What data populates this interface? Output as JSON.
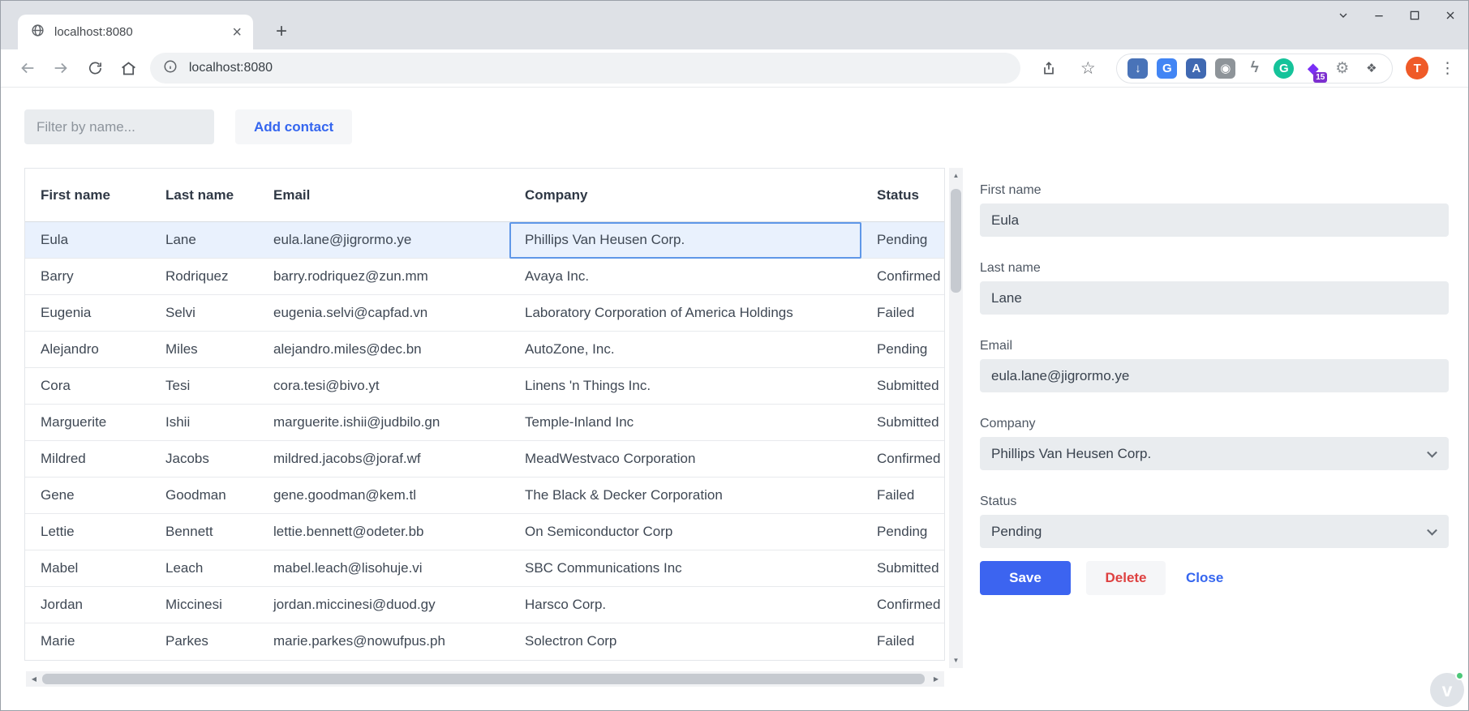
{
  "browser": {
    "tab_title": "localhost:8080",
    "url": "localhost:8080",
    "new_tab_label": "+",
    "tab_close_glyph": "×",
    "kebab_glyph": "⋮",
    "star_glyph": "☆",
    "profile_initial": "T",
    "extensions": [
      {
        "name": "download-extension-icon",
        "glyph": "↓",
        "bg": "#4973b8",
        "fg": "#ffffff",
        "round": false
      },
      {
        "name": "google-translate-icon",
        "glyph": "G",
        "bg": "#4285f4",
        "fg": "#ffffff",
        "round": false
      },
      {
        "name": "input-tools-icon",
        "glyph": "A",
        "bg": "#4069b2",
        "fg": "#ffffff",
        "round": false
      },
      {
        "name": "screenshot-camera-icon",
        "glyph": "◉",
        "bg": "#8e9499",
        "fg": "#ffffff",
        "round": false
      },
      {
        "name": "lightning-extension-icon",
        "glyph": "ϟ",
        "bg": "",
        "fg": "#80868b",
        "round": false
      },
      {
        "name": "grammarly-icon",
        "glyph": "G",
        "bg": "#15c39a",
        "fg": "#ffffff",
        "round": true
      },
      {
        "name": "purple-extension-icon",
        "glyph": "◆",
        "bg": "",
        "fg": "#7a2ff5",
        "round": false,
        "badge": "15"
      },
      {
        "name": "settings-gear-extension-icon",
        "glyph": "⚙",
        "bg": "",
        "fg": "#8b9095",
        "round": false
      },
      {
        "name": "extensions-puzzle-icon",
        "glyph": "❖",
        "bg": "",
        "fg": "#5f6368",
        "round": false
      }
    ]
  },
  "page": {
    "filter_placeholder": "Filter by name...",
    "add_contact_label": "Add contact"
  },
  "table": {
    "columns": [
      "First name",
      "Last name",
      "Email",
      "Company",
      "Status"
    ],
    "selected_row_index": 0,
    "focused_column": "company",
    "rows": [
      {
        "first": "Eula",
        "last": "Lane",
        "email": "eula.lane@jigrormo.ye",
        "company": "Phillips Van Heusen Corp.",
        "status": "Pending"
      },
      {
        "first": "Barry",
        "last": "Rodriquez",
        "email": "barry.rodriquez@zun.mm",
        "company": "Avaya Inc.",
        "status": "Confirmed"
      },
      {
        "first": "Eugenia",
        "last": "Selvi",
        "email": "eugenia.selvi@capfad.vn",
        "company": "Laboratory Corporation of America Holdings",
        "status": "Failed"
      },
      {
        "first": "Alejandro",
        "last": "Miles",
        "email": "alejandro.miles@dec.bn",
        "company": "AutoZone, Inc.",
        "status": "Pending"
      },
      {
        "first": "Cora",
        "last": "Tesi",
        "email": "cora.tesi@bivo.yt",
        "company": "Linens 'n Things Inc.",
        "status": "Submitted"
      },
      {
        "first": "Marguerite",
        "last": "Ishii",
        "email": "marguerite.ishii@judbilo.gn",
        "company": "Temple-Inland Inc",
        "status": "Submitted"
      },
      {
        "first": "Mildred",
        "last": "Jacobs",
        "email": "mildred.jacobs@joraf.wf",
        "company": "MeadWestvaco Corporation",
        "status": "Confirmed"
      },
      {
        "first": "Gene",
        "last": "Goodman",
        "email": "gene.goodman@kem.tl",
        "company": "The Black & Decker Corporation",
        "status": "Failed"
      },
      {
        "first": "Lettie",
        "last": "Bennett",
        "email": "lettie.bennett@odeter.bb",
        "company": "On Semiconductor Corp",
        "status": "Pending"
      },
      {
        "first": "Mabel",
        "last": "Leach",
        "email": "mabel.leach@lisohuje.vi",
        "company": "SBC Communications Inc",
        "status": "Submitted"
      },
      {
        "first": "Jordan",
        "last": "Miccinesi",
        "email": "jordan.miccinesi@duod.gy",
        "company": "Harsco Corp.",
        "status": "Confirmed"
      },
      {
        "first": "Marie",
        "last": "Parkes",
        "email": "marie.parkes@nowufpus.ph",
        "company": "Solectron Corp",
        "status": "Failed"
      }
    ]
  },
  "form": {
    "first_name": {
      "label": "First name",
      "value": "Eula"
    },
    "last_name": {
      "label": "Last name",
      "value": "Lane"
    },
    "email": {
      "label": "Email",
      "value": "eula.lane@jigrormo.ye"
    },
    "company": {
      "label": "Company",
      "value": "Phillips Van Heusen Corp."
    },
    "status": {
      "label": "Status",
      "value": "Pending"
    },
    "save_label": "Save",
    "delete_label": "Delete",
    "close_label": "Close"
  },
  "watermark": {
    "glyph": "v"
  },
  "colors": {
    "accent_blue": "#3c64f0",
    "link_blue": "#3566ef",
    "delete_red": "#de4040",
    "selected_row": "#e9f1fd",
    "focus_border": "#5f97e8",
    "input_gray": "#e9ecef",
    "tabstrip_gray": "#dee1e6",
    "avatar_orange": "#ef5a28",
    "grammarly_green": "#15c39a"
  }
}
